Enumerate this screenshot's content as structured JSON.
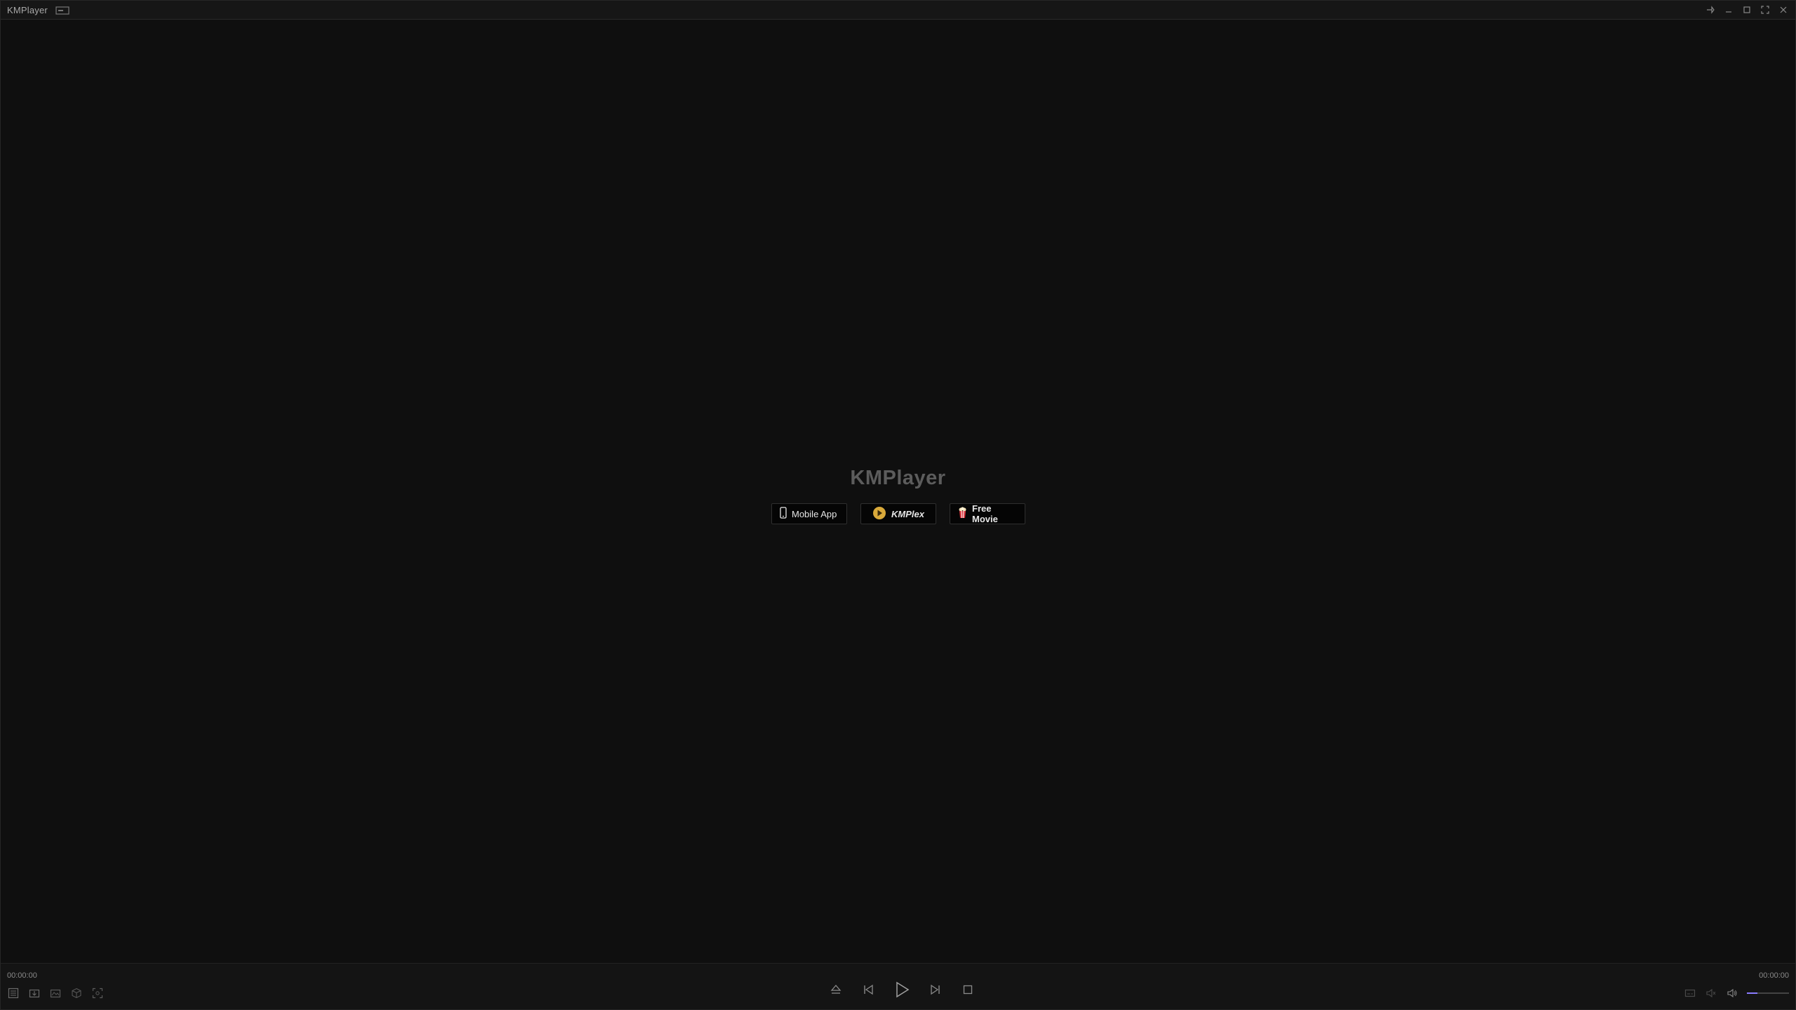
{
  "window": {
    "title": "KMPlayer"
  },
  "center": {
    "logo": "KMPlayer",
    "promos": [
      {
        "label": "Mobile App",
        "icon": "phone-icon"
      },
      {
        "label": "KMPlex",
        "icon": "kmplex-logo-icon"
      },
      {
        "label": "Free Movie",
        "icon": "popcorn-icon"
      }
    ]
  },
  "controls": {
    "current_time": "00:00:00",
    "total_time": "00:00:00",
    "volume_level": 0.25,
    "accent_color": "#8a7cff"
  }
}
